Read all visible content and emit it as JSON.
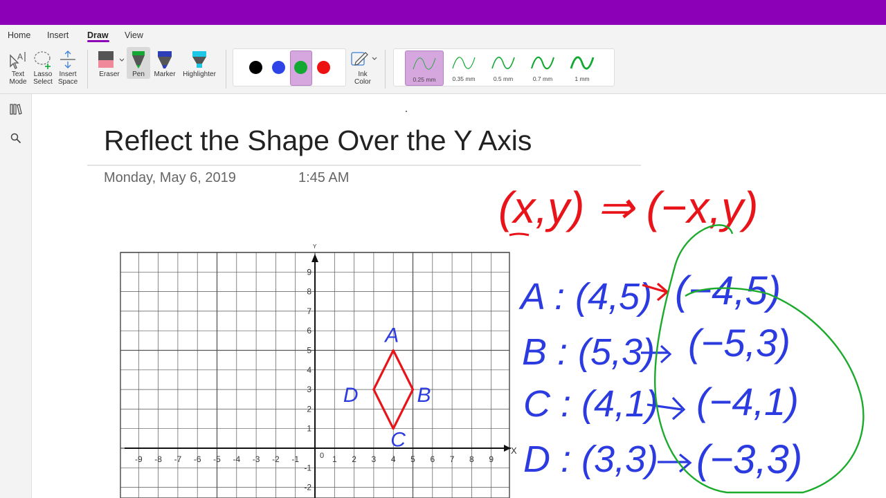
{
  "tabs": [
    {
      "label": "Home"
    },
    {
      "label": "Insert"
    },
    {
      "label": "Draw"
    },
    {
      "label": "View"
    }
  ],
  "tools": {
    "text_mode": "Text\nMode",
    "lasso_select": "Lasso\nSelect",
    "insert_space": "Insert\nSpace",
    "eraser": "Eraser",
    "pen": "Pen",
    "marker": "Marker",
    "highlighter": "Highlighter",
    "ink_color": "Ink\nColor"
  },
  "pen_colors": [
    "#000000",
    "#2e44e8",
    "#12a832",
    "#ee1111"
  ],
  "selected_color": "#12a832",
  "thicknesses": [
    "0.25 mm",
    "0.35 mm",
    "0.5 mm",
    "0.7 mm",
    "1 mm"
  ],
  "selected_thickness": "0.25 mm",
  "page": {
    "title": "Reflect the Shape Over the Y Axis",
    "date": "Monday, May 6, 2019",
    "time": "1:45 AM"
  },
  "graph": {
    "x_axis_label": "X",
    "y_axis_label": "Y",
    "x_ticks": [
      "-9",
      "-8",
      "-7",
      "-6",
      "-5",
      "-4",
      "-3",
      "-2",
      "-1",
      "1",
      "2",
      "3",
      "4",
      "5",
      "6",
      "7",
      "8",
      "9"
    ],
    "y_ticks": [
      "9",
      "8",
      "7",
      "6",
      "5",
      "4",
      "3",
      "2",
      "1",
      "-1",
      "-2"
    ],
    "origin_label": "0",
    "shape_points": [
      [
        4,
        5
      ],
      [
        5,
        3
      ],
      [
        4,
        1
      ],
      [
        3,
        3
      ]
    ],
    "vertex_labels": [
      "A",
      "B",
      "C",
      "D"
    ]
  },
  "ink_notes": {
    "rule": "(x,y) ⇒ (−x,y)",
    "rows": [
      {
        "left": "A : (4,5)",
        "right": "(−4,5)"
      },
      {
        "left": "B : (5,3)",
        "right": "(−5,3)"
      },
      {
        "left": "C : (4,1)",
        "right": "(−4,1)"
      },
      {
        "left": "D : (3,3)",
        "right": "(−3,3)"
      }
    ]
  },
  "colors": {
    "brand": "#8c00b8",
    "ink_red": "#e8141a",
    "ink_blue": "#2b3be0",
    "ink_green": "#1caa2c"
  }
}
